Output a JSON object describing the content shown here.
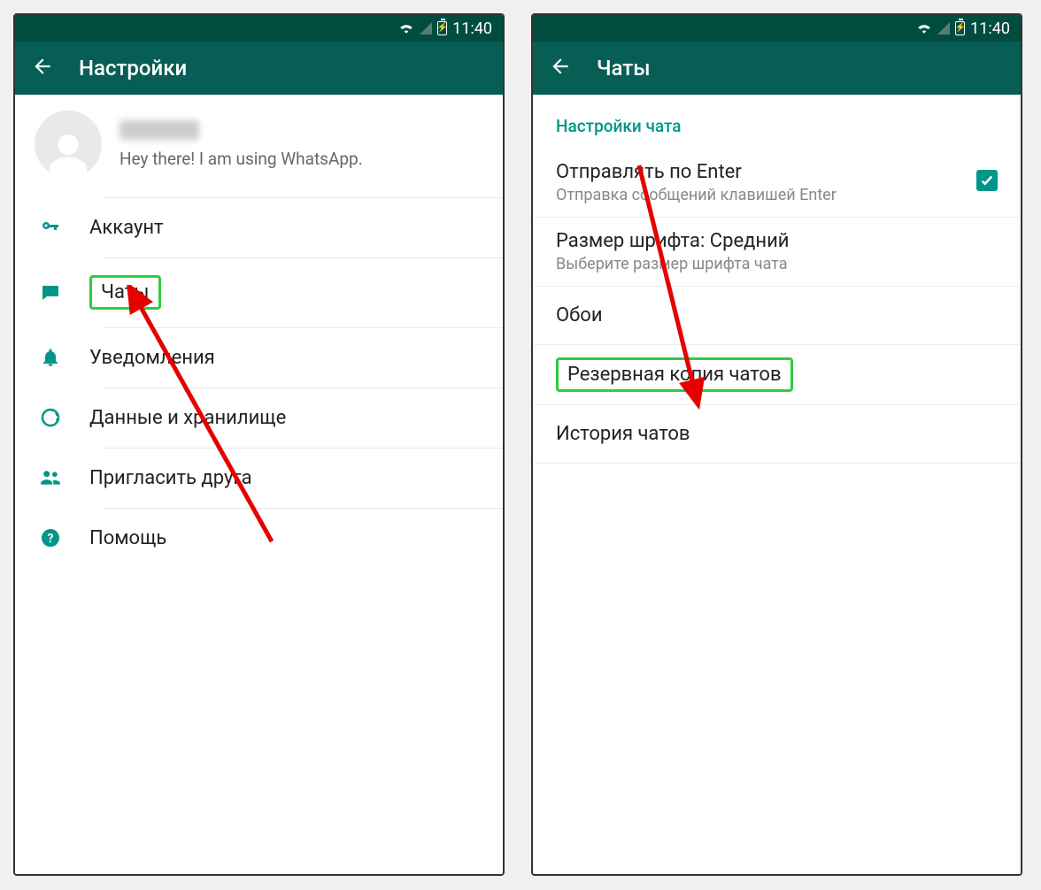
{
  "statusbar": {
    "time": "11:40"
  },
  "left": {
    "appbar": {
      "title": "Настройки"
    },
    "profile": {
      "status": "Hey there! I am using WhatsApp."
    },
    "menu": {
      "account": "Аккаунт",
      "chats": "Чаты",
      "notifications": "Уведомления",
      "data": "Данные и хранилище",
      "invite": "Пригласить друга",
      "help": "Помощь"
    }
  },
  "right": {
    "appbar": {
      "title": "Чаты"
    },
    "section": "Настройки чата",
    "items": {
      "enter": {
        "title": "Отправлять по Enter",
        "sub": "Отправка сообщений клавишей Enter",
        "checked": true
      },
      "font": {
        "title": "Размер шрифта: Средний",
        "sub": "Выберите размер шрифта чата"
      },
      "wallpaper": {
        "title": "Обои"
      },
      "backup": {
        "title": "Резервная копия чатов"
      },
      "history": {
        "title": "История чатов"
      }
    }
  }
}
